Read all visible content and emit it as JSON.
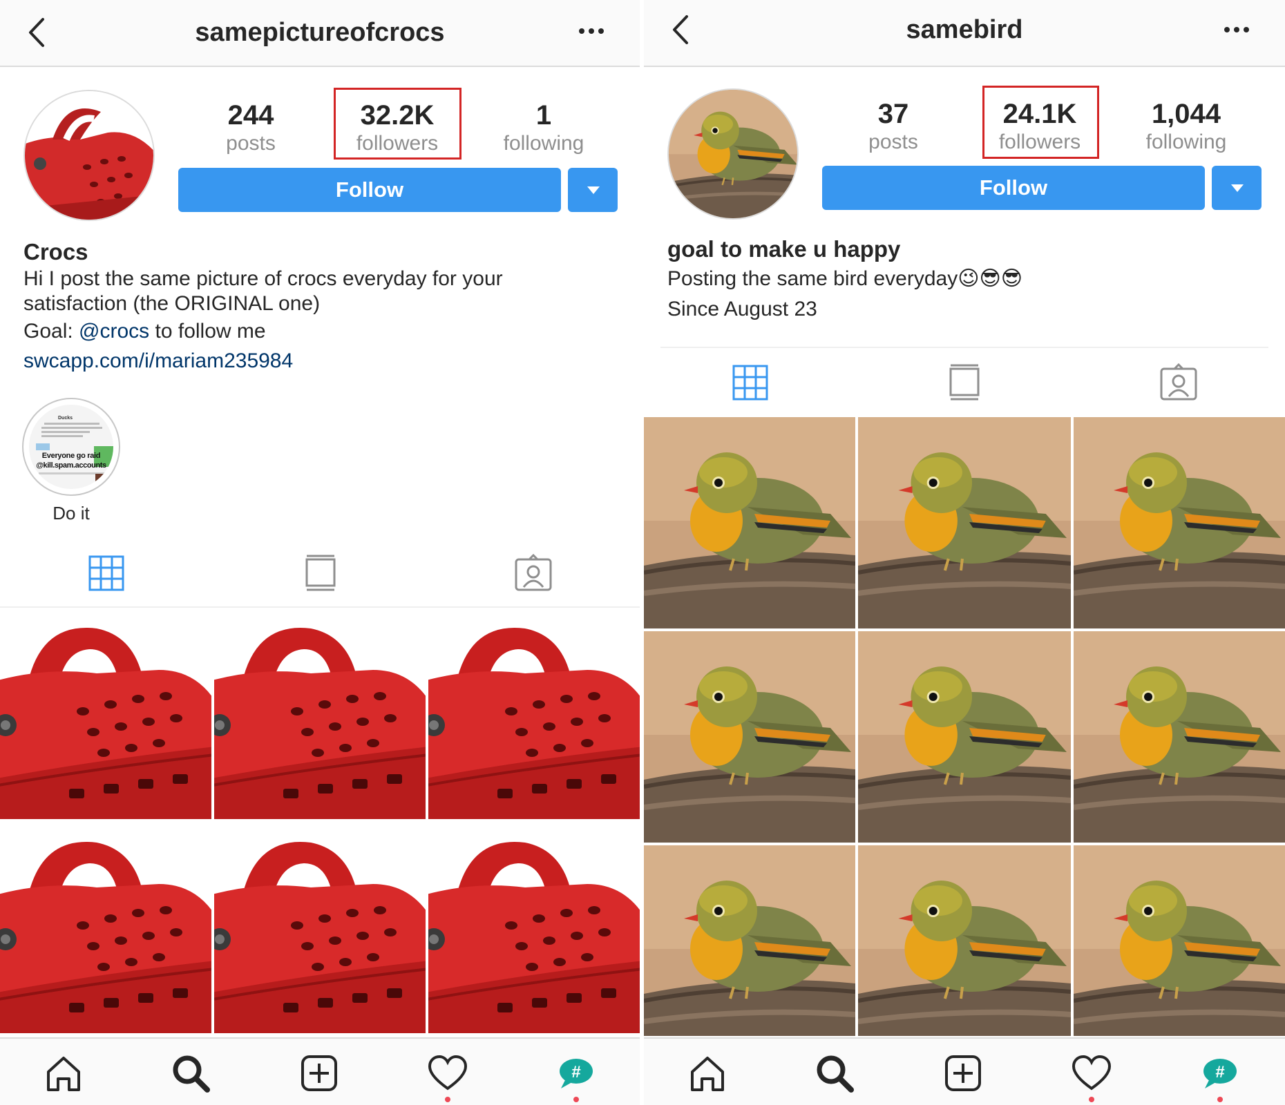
{
  "left": {
    "username": "samepictureofcrocs",
    "stats": [
      {
        "num": "244",
        "label": "posts"
      },
      {
        "num": "32.2K",
        "label": "followers"
      },
      {
        "num": "1",
        "label": "following"
      }
    ],
    "follow_label": "Follow",
    "bio_name": "Crocs",
    "bio_line1": "Hi I post the same picture of crocs everyday for your",
    "bio_line2": "satisfaction (the ORIGINAL one)",
    "goal_prefix": "Goal: ",
    "goal_mention": "@crocs",
    "goal_suffix": " to follow me",
    "link": "swcapp.com/i/mariam235984",
    "highlight": {
      "label": "Do it",
      "inner_title": "Ducks",
      "inner_line1": "Everyone go raid",
      "inner_line2": "@kill.spam.accounts"
    }
  },
  "right": {
    "username": "samebird",
    "stats": [
      {
        "num": "37",
        "label": "posts"
      },
      {
        "num": "24.1K",
        "label": "followers"
      },
      {
        "num": "1,044",
        "label": "following"
      }
    ],
    "follow_label": "Follow",
    "bio_name": "goal to make u happy",
    "bio_line1": "Posting the same bird everyday",
    "bio_emojis": "😉😎😎",
    "bio_line2": "Since August 23"
  },
  "icons": {
    "back": "chevron-left-icon",
    "more": "more-options-icon",
    "grid_tab": "grid-icon",
    "feed_tab": "feed-icon",
    "tagged_tab": "tagged-icon",
    "home": "home-icon",
    "search": "search-icon",
    "add": "add-post-icon",
    "activity": "heart-icon",
    "profile": "hashtag-bubble-icon"
  },
  "colors": {
    "follow_blue": "#3897f0",
    "highlight_red": "#d32525",
    "notification_dot": "#ed4956"
  }
}
